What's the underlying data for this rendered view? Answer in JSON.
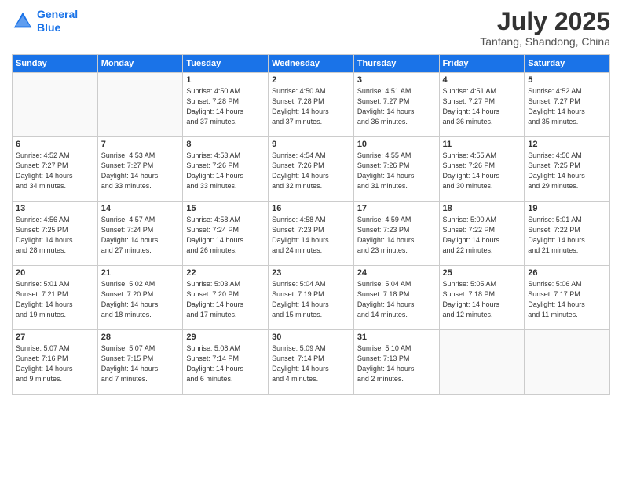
{
  "header": {
    "logo_line1": "General",
    "logo_line2": "Blue",
    "month": "July 2025",
    "location": "Tanfang, Shandong, China"
  },
  "weekdays": [
    "Sunday",
    "Monday",
    "Tuesday",
    "Wednesday",
    "Thursday",
    "Friday",
    "Saturday"
  ],
  "weeks": [
    [
      {
        "num": "",
        "info": ""
      },
      {
        "num": "",
        "info": ""
      },
      {
        "num": "1",
        "info": "Sunrise: 4:50 AM\nSunset: 7:28 PM\nDaylight: 14 hours\nand 37 minutes."
      },
      {
        "num": "2",
        "info": "Sunrise: 4:50 AM\nSunset: 7:28 PM\nDaylight: 14 hours\nand 37 minutes."
      },
      {
        "num": "3",
        "info": "Sunrise: 4:51 AM\nSunset: 7:27 PM\nDaylight: 14 hours\nand 36 minutes."
      },
      {
        "num": "4",
        "info": "Sunrise: 4:51 AM\nSunset: 7:27 PM\nDaylight: 14 hours\nand 36 minutes."
      },
      {
        "num": "5",
        "info": "Sunrise: 4:52 AM\nSunset: 7:27 PM\nDaylight: 14 hours\nand 35 minutes."
      }
    ],
    [
      {
        "num": "6",
        "info": "Sunrise: 4:52 AM\nSunset: 7:27 PM\nDaylight: 14 hours\nand 34 minutes."
      },
      {
        "num": "7",
        "info": "Sunrise: 4:53 AM\nSunset: 7:27 PM\nDaylight: 14 hours\nand 33 minutes."
      },
      {
        "num": "8",
        "info": "Sunrise: 4:53 AM\nSunset: 7:26 PM\nDaylight: 14 hours\nand 33 minutes."
      },
      {
        "num": "9",
        "info": "Sunrise: 4:54 AM\nSunset: 7:26 PM\nDaylight: 14 hours\nand 32 minutes."
      },
      {
        "num": "10",
        "info": "Sunrise: 4:55 AM\nSunset: 7:26 PM\nDaylight: 14 hours\nand 31 minutes."
      },
      {
        "num": "11",
        "info": "Sunrise: 4:55 AM\nSunset: 7:26 PM\nDaylight: 14 hours\nand 30 minutes."
      },
      {
        "num": "12",
        "info": "Sunrise: 4:56 AM\nSunset: 7:25 PM\nDaylight: 14 hours\nand 29 minutes."
      }
    ],
    [
      {
        "num": "13",
        "info": "Sunrise: 4:56 AM\nSunset: 7:25 PM\nDaylight: 14 hours\nand 28 minutes."
      },
      {
        "num": "14",
        "info": "Sunrise: 4:57 AM\nSunset: 7:24 PM\nDaylight: 14 hours\nand 27 minutes."
      },
      {
        "num": "15",
        "info": "Sunrise: 4:58 AM\nSunset: 7:24 PM\nDaylight: 14 hours\nand 26 minutes."
      },
      {
        "num": "16",
        "info": "Sunrise: 4:58 AM\nSunset: 7:23 PM\nDaylight: 14 hours\nand 24 minutes."
      },
      {
        "num": "17",
        "info": "Sunrise: 4:59 AM\nSunset: 7:23 PM\nDaylight: 14 hours\nand 23 minutes."
      },
      {
        "num": "18",
        "info": "Sunrise: 5:00 AM\nSunset: 7:22 PM\nDaylight: 14 hours\nand 22 minutes."
      },
      {
        "num": "19",
        "info": "Sunrise: 5:01 AM\nSunset: 7:22 PM\nDaylight: 14 hours\nand 21 minutes."
      }
    ],
    [
      {
        "num": "20",
        "info": "Sunrise: 5:01 AM\nSunset: 7:21 PM\nDaylight: 14 hours\nand 19 minutes."
      },
      {
        "num": "21",
        "info": "Sunrise: 5:02 AM\nSunset: 7:20 PM\nDaylight: 14 hours\nand 18 minutes."
      },
      {
        "num": "22",
        "info": "Sunrise: 5:03 AM\nSunset: 7:20 PM\nDaylight: 14 hours\nand 17 minutes."
      },
      {
        "num": "23",
        "info": "Sunrise: 5:04 AM\nSunset: 7:19 PM\nDaylight: 14 hours\nand 15 minutes."
      },
      {
        "num": "24",
        "info": "Sunrise: 5:04 AM\nSunset: 7:18 PM\nDaylight: 14 hours\nand 14 minutes."
      },
      {
        "num": "25",
        "info": "Sunrise: 5:05 AM\nSunset: 7:18 PM\nDaylight: 14 hours\nand 12 minutes."
      },
      {
        "num": "26",
        "info": "Sunrise: 5:06 AM\nSunset: 7:17 PM\nDaylight: 14 hours\nand 11 minutes."
      }
    ],
    [
      {
        "num": "27",
        "info": "Sunrise: 5:07 AM\nSunset: 7:16 PM\nDaylight: 14 hours\nand 9 minutes."
      },
      {
        "num": "28",
        "info": "Sunrise: 5:07 AM\nSunset: 7:15 PM\nDaylight: 14 hours\nand 7 minutes."
      },
      {
        "num": "29",
        "info": "Sunrise: 5:08 AM\nSunset: 7:14 PM\nDaylight: 14 hours\nand 6 minutes."
      },
      {
        "num": "30",
        "info": "Sunrise: 5:09 AM\nSunset: 7:14 PM\nDaylight: 14 hours\nand 4 minutes."
      },
      {
        "num": "31",
        "info": "Sunrise: 5:10 AM\nSunset: 7:13 PM\nDaylight: 14 hours\nand 2 minutes."
      },
      {
        "num": "",
        "info": ""
      },
      {
        "num": "",
        "info": ""
      }
    ]
  ]
}
